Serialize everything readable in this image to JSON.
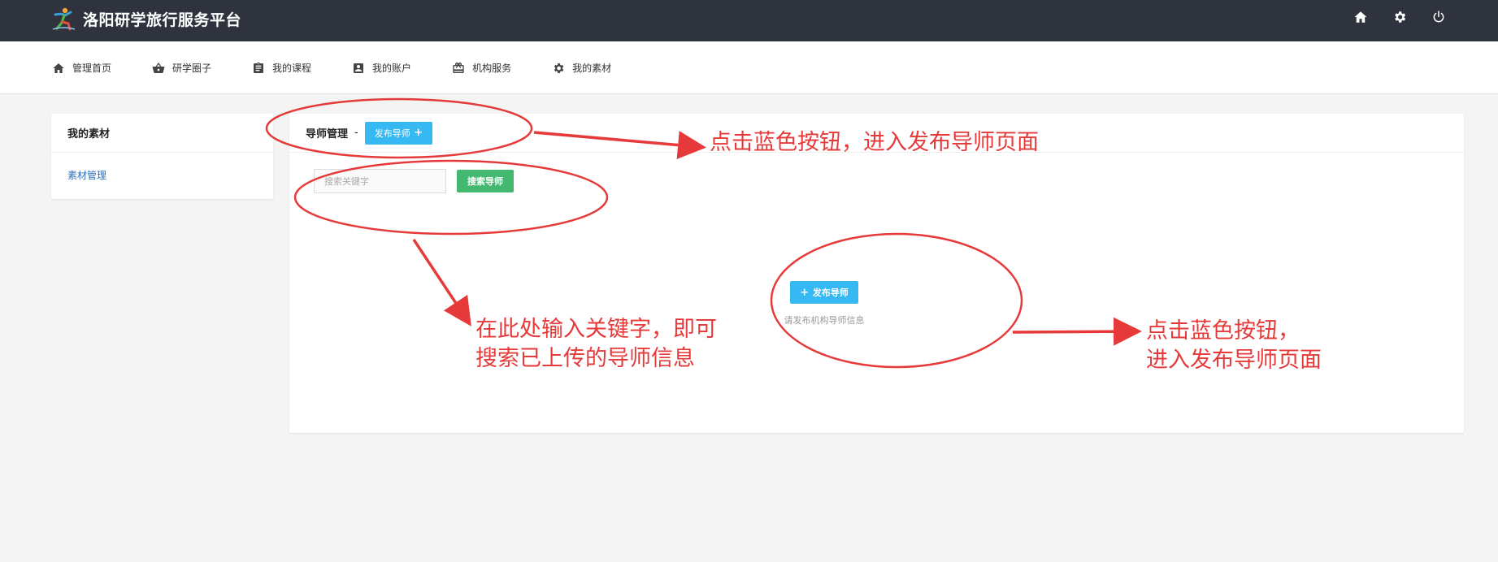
{
  "header": {
    "title": "洛阳研学旅行服务平台",
    "logo_icon": "person-logo-icon",
    "icons": [
      "home-icon",
      "gear-icon",
      "power-icon"
    ]
  },
  "nav": {
    "items": [
      {
        "label": "管理首页",
        "icon": "home-icon"
      },
      {
        "label": "研学圈子",
        "icon": "basket-icon"
      },
      {
        "label": "我的课程",
        "icon": "clipboard-icon"
      },
      {
        "label": "我的账户",
        "icon": "account-box-icon"
      },
      {
        "label": "机构服务",
        "icon": "gift-icon"
      },
      {
        "label": "我的素材",
        "icon": "gear-icon"
      }
    ]
  },
  "sidebar": {
    "title": "我的素材",
    "items": [
      {
        "label": "素材管理"
      }
    ]
  },
  "main": {
    "title": "导师管理",
    "separator": "-",
    "publish_button_label": "发布导师",
    "search": {
      "placeholder": "搜索关键字",
      "value": "",
      "button_label": "搜索导师"
    },
    "empty": {
      "button_label": "发布导师",
      "text": "请发布机构导师信息"
    }
  },
  "annotations": {
    "note_top": "点击蓝色按钮，进入发布导师页面",
    "note_search_line1": "在此处输入关键字，即可",
    "note_search_line2": "搜索已上传的导师信息",
    "note_right_line1": "点击蓝色按钮，",
    "note_right_line2": "进入发布导师页面",
    "color": "#e63a3a"
  },
  "colors": {
    "topbar": "#2e333d",
    "primary_blue": "#36b9f2",
    "search_green": "#43b86f",
    "link_blue": "#2e6fb8",
    "page_bg": "#f4f4f4"
  }
}
